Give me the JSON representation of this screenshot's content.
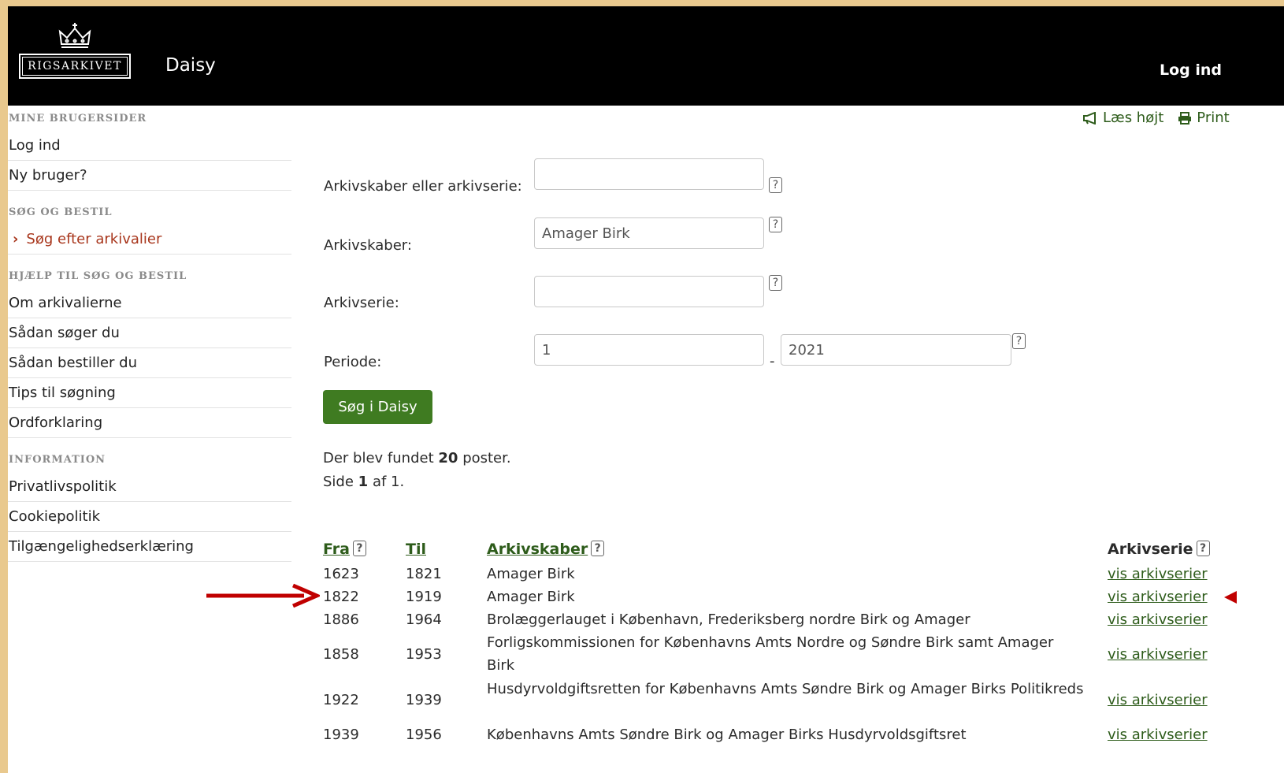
{
  "header": {
    "logo_text": "RIGSARKIVET",
    "app_title": "Daisy",
    "login": "Log ind"
  },
  "tools": {
    "read_aloud": "Læs højt",
    "print": "Print"
  },
  "sidebar": {
    "sections": [
      {
        "heading": "MINE BRUGERSIDER",
        "items": [
          {
            "label": "Log ind"
          },
          {
            "label": "Ny bruger?"
          }
        ]
      },
      {
        "heading": "SØG OG BESTIL",
        "items": [
          {
            "label": "Søg efter arkivalier",
            "active": true
          }
        ]
      },
      {
        "heading": "HJÆLP TIL SØG OG BESTIL",
        "items": [
          {
            "label": "Om arkivalierne"
          },
          {
            "label": "Sådan søger du"
          },
          {
            "label": "Sådan bestiller du"
          },
          {
            "label": "Tips til søgning"
          },
          {
            "label": "Ordforklaring"
          }
        ]
      },
      {
        "heading": "INFORMATION",
        "items": [
          {
            "label": "Privatlivspolitik"
          },
          {
            "label": "Cookiepolitik"
          },
          {
            "label": "Tilgængelighedserklæring"
          }
        ]
      }
    ]
  },
  "form": {
    "label_creator_or_series": "Arkivskaber eller arkivserie:",
    "value_creator_or_series": "",
    "label_creator": "Arkivskaber:",
    "value_creator": "Amager Birk",
    "label_series": "Arkivserie:",
    "value_series": "",
    "label_period": "Periode:",
    "period_from": "1",
    "period_separator": "-",
    "period_to": "2021",
    "help_glyph": "?",
    "search_button": "Søg i Daisy"
  },
  "results": {
    "found_prefix": "Der blev fundet",
    "found_count": "20",
    "found_suffix": "poster.",
    "page_prefix": "Side",
    "page_current": "1",
    "page_suffix": "af 1."
  },
  "table": {
    "headers": {
      "from": "Fra",
      "to": "Til",
      "creator": "Arkivskaber",
      "series": "Arkivserie"
    },
    "rows": [
      {
        "from": "1623",
        "to": "1821",
        "creator": "Amager Birk",
        "link": "vis arkivserier"
      },
      {
        "from": "1822",
        "to": "1919",
        "creator": "Amager Birk",
        "link": "vis arkivserier"
      },
      {
        "from": "1886",
        "to": "1964",
        "creator": "Brolæggerlauget i København, Frederiksberg nordre Birk og Amager",
        "link": "vis arkivserier"
      },
      {
        "from": "1858",
        "to": "1953",
        "creator": "Forligskommissionen for Københavns Amts Nordre og Søndre Birk samt Amager Birk",
        "link": "vis arkivserier"
      },
      {
        "from": "1922",
        "to": "1939",
        "creator": "Husdyrvoldgiftsretten for Københavns Amts Søndre Birk og Amager Birks Politikreds",
        "link": "vis arkivserier"
      },
      {
        "from": "1939",
        "to": "1956",
        "creator": "Københavns Amts Søndre Birk og Amager Birks Husdyrvoldsgiftsret",
        "link": "vis arkivserier"
      }
    ]
  },
  "colors": {
    "accent_green": "#3f7b21",
    "link_green": "#2e5c1b",
    "active_red": "#a8361c",
    "arrow_red": "#c00000"
  }
}
